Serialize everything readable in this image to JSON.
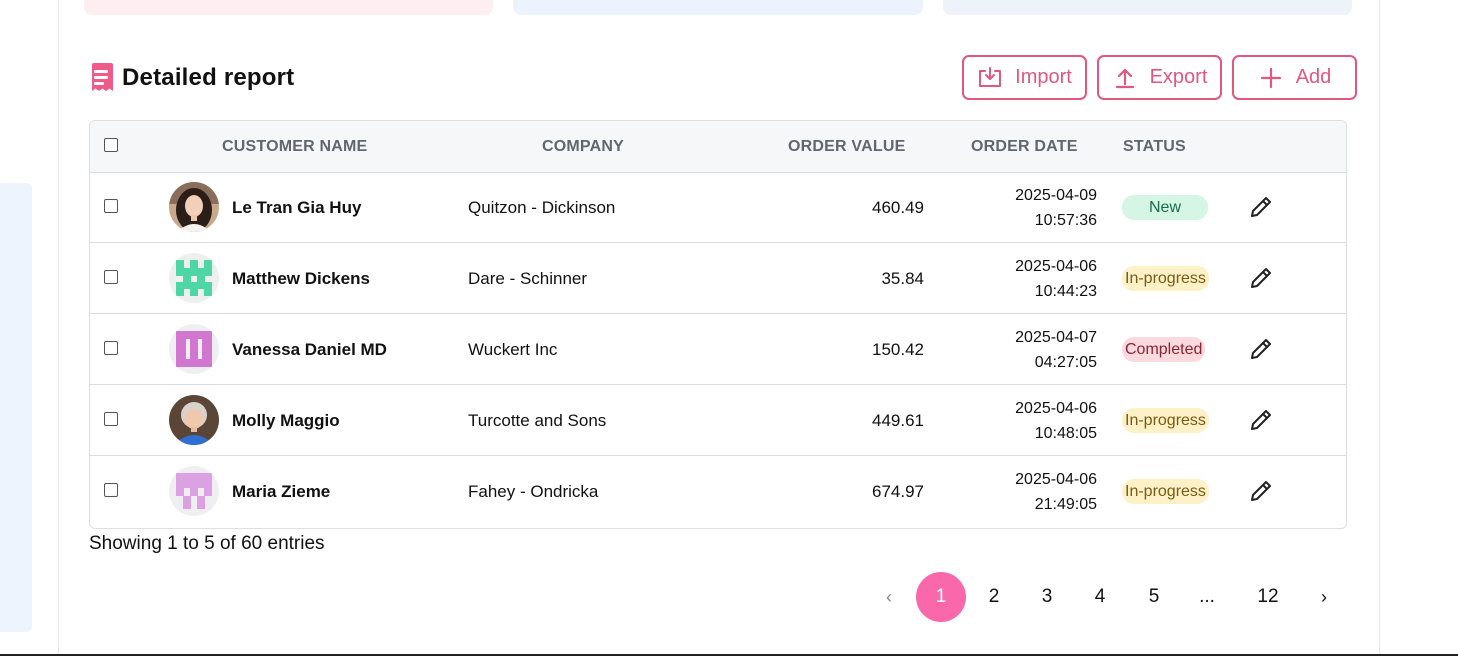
{
  "header": {
    "title": "Detailed report",
    "import_label": "Import",
    "export_label": "Export",
    "add_label": "Add"
  },
  "colors": {
    "accent": "#e2577f",
    "pager_active": "#f868ab"
  },
  "table": {
    "columns": {
      "customer": "CUSTOMER NAME",
      "company": "COMPANY",
      "order_value": "ORDER VALUE",
      "order_date": "ORDER DATE",
      "status": "STATUS"
    },
    "rows": [
      {
        "name": "Le Tran Gia Huy",
        "company": "Quitzon - Dickinson",
        "value": "460.49",
        "date": "2025-04-09",
        "time": "10:57:36",
        "status": "New",
        "avatar": "photo-woman-dark-hair"
      },
      {
        "name": "Matthew Dickens",
        "company": "Dare - Schinner",
        "value": "35.84",
        "date": "2025-04-06",
        "time": "10:44:23",
        "status": "In-progress",
        "avatar": "identicon-green"
      },
      {
        "name": "Vanessa Daniel MD",
        "company": "Wuckert Inc",
        "value": "150.42",
        "date": "2025-04-07",
        "time": "04:27:05",
        "status": "Completed",
        "avatar": "identicon-magenta"
      },
      {
        "name": "Molly Maggio",
        "company": "Turcotte and Sons",
        "value": "449.61",
        "date": "2025-04-06",
        "time": "10:48:05",
        "status": "In-progress",
        "avatar": "photo-elderly-woman"
      },
      {
        "name": "Maria Zieme",
        "company": "Fahey - Ondricka",
        "value": "674.97",
        "date": "2025-04-06",
        "time": "21:49:05",
        "status": "In-progress",
        "avatar": "identicon-lilac"
      }
    ]
  },
  "footer": {
    "summary": "Showing 1 to 5 of 60 entries"
  },
  "pagination": {
    "prev": "‹",
    "pages": [
      "1",
      "2",
      "3",
      "4",
      "5"
    ],
    "ellipsis": "...",
    "last": "12",
    "next": "›",
    "current": "1"
  }
}
